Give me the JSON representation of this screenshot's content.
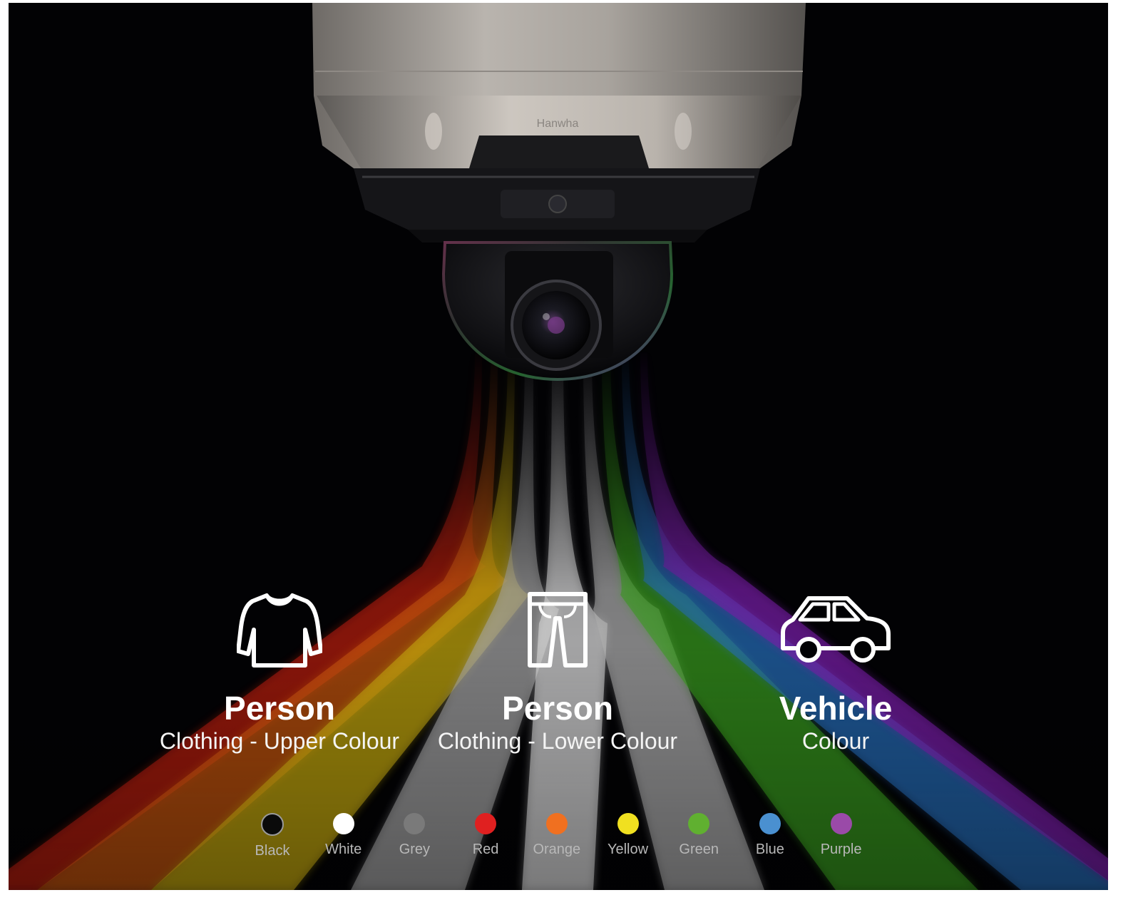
{
  "brand": {
    "logo_text": "Hanwha"
  },
  "categories": [
    {
      "id": "upper",
      "icon": "shirt-icon",
      "title": "Person",
      "subtitle": "Clothing - Upper Colour"
    },
    {
      "id": "lower",
      "icon": "pants-icon",
      "title": "Person",
      "subtitle": "Clothing - Lower Colour"
    },
    {
      "id": "vehicle",
      "icon": "car-icon",
      "title": "Vehicle",
      "subtitle": "Colour"
    }
  ],
  "colors": [
    {
      "label": "Black",
      "hex": "#0a0a0a"
    },
    {
      "label": "White",
      "hex": "#ffffff"
    },
    {
      "label": "Grey",
      "hex": "#7a7a7a"
    },
    {
      "label": "Red",
      "hex": "#e02020"
    },
    {
      "label": "Orange",
      "hex": "#f07020"
    },
    {
      "label": "Yellow",
      "hex": "#f0e020"
    },
    {
      "label": "Green",
      "hex": "#60b030"
    },
    {
      "label": "Blue",
      "hex": "#4a90d0"
    },
    {
      "label": "Purple",
      "hex": "#9a4aa8"
    }
  ]
}
